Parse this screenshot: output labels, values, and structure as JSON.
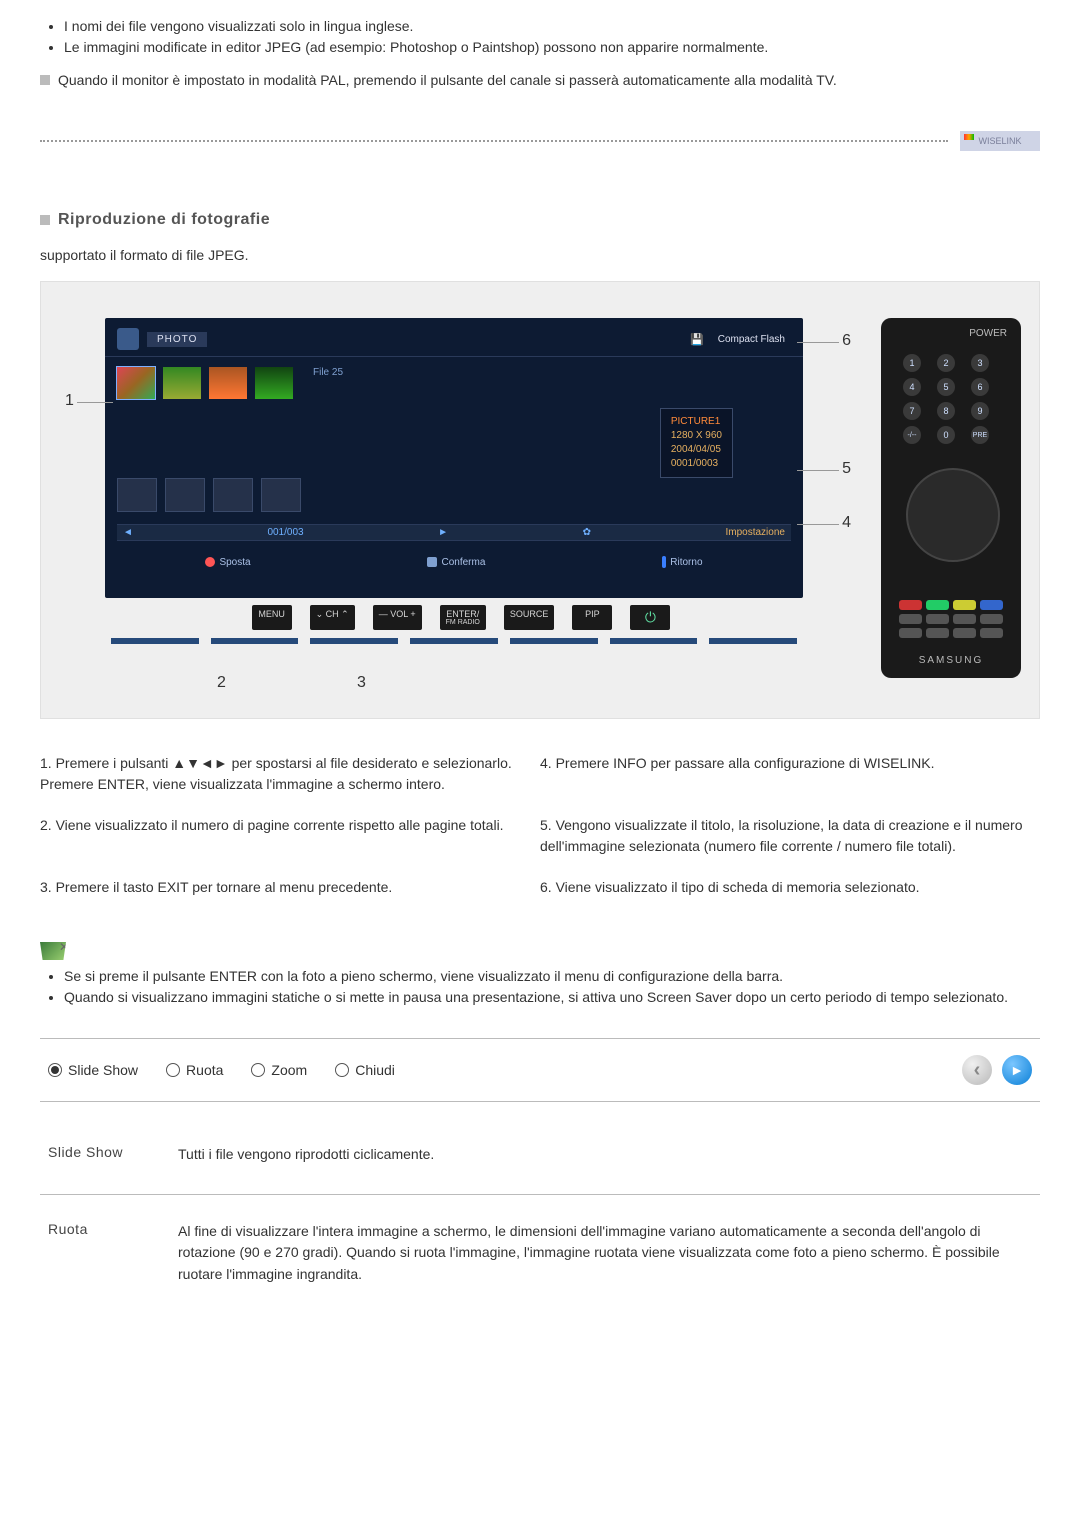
{
  "top_notes": {
    "bullets": [
      "I nomi dei file vengono visualizzati solo in lingua inglese.",
      "Le immagini modificate in editor JPEG (ad esempio: Photoshop o Paintshop) possono non apparire normalmente."
    ],
    "footnote": "Quando il monitor è impostato in modalità PAL, premendo il pulsante del canale si passerà automaticamente alla modalità TV."
  },
  "wiselink_chip": "WISELINK",
  "section": {
    "heading": "Riproduzione di fotografie",
    "sub": "supportato il formato di file JPEG."
  },
  "figure": {
    "photo_label": "PHOTO",
    "media_icon": "💾",
    "media_label": "Compact Flash",
    "folder_label": "File 25",
    "info": {
      "name": "PICTURE1",
      "res": "1280 X 960",
      "date": "2004/04/05",
      "index": "0001/0003"
    },
    "page": {
      "left_arrow": "◄",
      "counter": "001/003",
      "right_arrow": "►",
      "gear": "✿",
      "settings": "Impostazione"
    },
    "controls": {
      "sposta": "Sposta",
      "conferma": "Conferma",
      "ritorno": "Ritorno"
    },
    "remote_buttons": {
      "menu": "MENU",
      "ch_down": "⌄ CH",
      "ch_up": "⌃",
      "vol_minus": "— VOL",
      "vol_plus": "+",
      "enter": "ENTER/",
      "enter_sub": "FM RADIO",
      "source": "SOURCE",
      "pip": "PIP",
      "power": "⏻"
    },
    "callouts": {
      "n1": "1",
      "n2": "2",
      "n3": "3",
      "n4": "4",
      "n5": "5",
      "n6": "6"
    },
    "remote_brand": "SAMSUNG",
    "remote_power_label": "POWER"
  },
  "instructions": {
    "r1l": "1. Premere i pulsanti ▲▼◄► per spostarsi al file desiderato e selezionarlo. Premere ENTER, viene visualizzata l'immagine a schermo intero.",
    "r1r": "4. Premere INFO per passare alla configurazione di WISELINK.",
    "r2l": "2. Viene visualizzato il numero di pagine corrente rispetto alle pagine totali.",
    "r2r": "5. Vengono visualizzate il titolo, la risoluzione, la data di creazione e il numero dell'immagine selezionata (numero file corrente / numero file totali).",
    "r3l": "3. Premere il tasto EXIT per tornare al menu precedente.",
    "r3r": "6. Viene visualizzato il tipo di scheda di memoria selezionato."
  },
  "mid_notes": {
    "bullets": [
      "Se si preme il pulsante ENTER con la foto a pieno schermo, viene visualizzato il menu di configurazione della barra.",
      "Quando si visualizzano immagini statiche o si mette in pausa una presentazione, si attiva uno Screen Saver dopo un certo periodo di tempo selezionato."
    ]
  },
  "options": {
    "slide_show": "Slide Show",
    "ruota": "Ruota",
    "zoom": "Zoom",
    "chiudi": "Chiudi"
  },
  "definitions": {
    "slide_show": {
      "term": "Slide Show",
      "desc": "Tutti i file vengono riprodotti ciclicamente."
    },
    "ruota": {
      "term": "Ruota",
      "desc": "Al fine di visualizzare l'intera immagine a schermo, le dimensioni dell'immagine variano automaticamente a seconda dell'angolo di rotazione (90 e 270 gradi). Quando si ruota l'immagine, l'immagine ruotata viene visualizzata come foto a pieno schermo. È possibile ruotare l'immagine ingrandita."
    }
  }
}
